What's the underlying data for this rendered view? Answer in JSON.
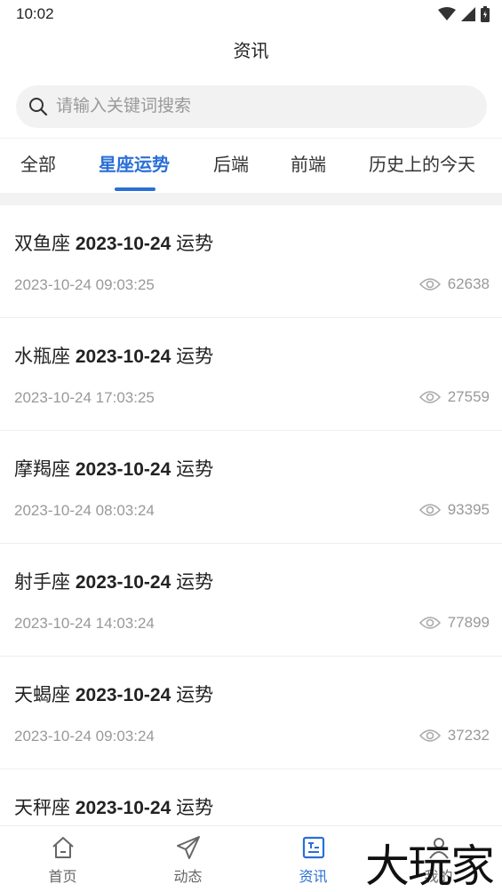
{
  "status_bar": {
    "time": "10:02"
  },
  "header": {
    "title": "资讯"
  },
  "search": {
    "placeholder": "请输入关键词搜索"
  },
  "tabs": [
    {
      "label": "全部",
      "active": false
    },
    {
      "label": "星座运势",
      "active": true
    },
    {
      "label": "后端",
      "active": false
    },
    {
      "label": "前端",
      "active": false
    },
    {
      "label": "历史上的今天",
      "active": false
    }
  ],
  "list": [
    {
      "name": "双鱼座",
      "date": "2023-10-24",
      "suffix": "运势",
      "time": "2023-10-24 09:03:25",
      "views": "62638"
    },
    {
      "name": "水瓶座",
      "date": "2023-10-24",
      "suffix": "运势",
      "time": "2023-10-24 17:03:25",
      "views": "27559"
    },
    {
      "name": "摩羯座",
      "date": "2023-10-24",
      "suffix": "运势",
      "time": "2023-10-24 08:03:24",
      "views": "93395"
    },
    {
      "name": "射手座",
      "date": "2023-10-24",
      "suffix": "运势",
      "time": "2023-10-24 14:03:24",
      "views": "77899"
    },
    {
      "name": "天蝎座",
      "date": "2023-10-24",
      "suffix": "运势",
      "time": "2023-10-24 09:03:24",
      "views": "37232"
    },
    {
      "name": "天秤座",
      "date": "2023-10-24",
      "suffix": "运势",
      "time": "",
      "views": ""
    }
  ],
  "bottom_nav": [
    {
      "label": "首页",
      "icon": "home-icon",
      "active": false
    },
    {
      "label": "动态",
      "icon": "paper-plane-icon",
      "active": false
    },
    {
      "label": "资讯",
      "icon": "news-icon",
      "active": true
    },
    {
      "label": "我的",
      "icon": "user-icon",
      "active": false
    }
  ],
  "watermark": {
    "text": "大玩家"
  },
  "colors": {
    "accent": "#2a6fd6",
    "muted": "#999999",
    "background_band": "#f2f2f2"
  }
}
